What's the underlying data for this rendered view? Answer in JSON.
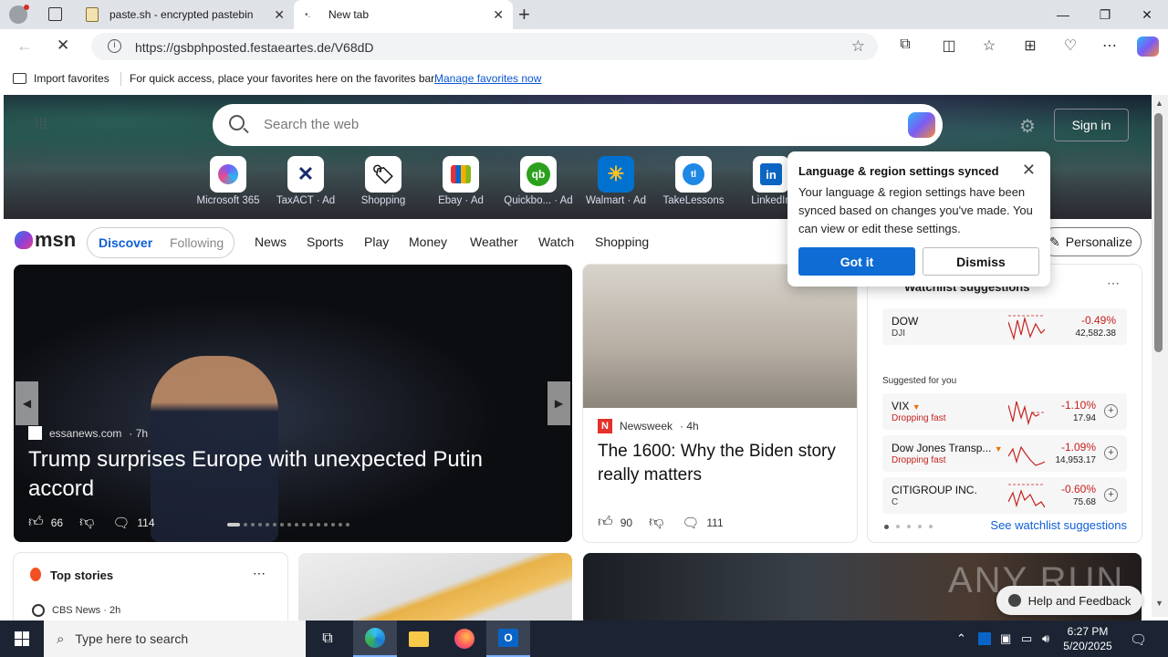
{
  "browser": {
    "tabs": [
      {
        "label": "paste.sh - encrypted pastebin"
      },
      {
        "label": "New tab"
      }
    ],
    "url": "https://gsbphposted.festaeartes.de/V68dD",
    "favorites_bar": {
      "import_label": "Import favorites",
      "message": "For quick access, place your favorites here on the favorites bar.",
      "manage_link": "Manage favorites now"
    }
  },
  "hero": {
    "search_placeholder": "Search the web",
    "signin_label": "Sign in",
    "quick_links": [
      {
        "label": "Microsoft 365",
        "icon": "microsoft-365-icon"
      },
      {
        "label": "TaxACT · Ad",
        "icon": "taxact-icon"
      },
      {
        "label": "Shopping",
        "icon": "shopping-tag-icon"
      },
      {
        "label": "Ebay · Ad",
        "icon": "ebay-icon"
      },
      {
        "label": "Quickbo... · Ad",
        "icon": "quickbooks-icon"
      },
      {
        "label": "Walmart · Ad",
        "icon": "walmart-icon"
      },
      {
        "label": "TakeLessons",
        "icon": "takelessons-icon"
      },
      {
        "label": "LinkedIn",
        "icon": "linkedin-icon"
      }
    ]
  },
  "msn_nav": {
    "logo": "msn",
    "discover": "Discover",
    "following": "Following",
    "items": [
      "News",
      "Sports",
      "Play",
      "Money",
      "Weather",
      "Watch",
      "Shopping"
    ],
    "personalize": "Personalize"
  },
  "main_story": {
    "source": "essanews.com",
    "age": "· 7h",
    "headline": "Trump surprises Europe with unexpected Putin accord",
    "likes": "66",
    "comments": "114"
  },
  "news_card": {
    "source": "Newsweek",
    "age": "· 4h",
    "headline": "The 1600: Why the Biden story really matters",
    "likes": "90",
    "comments": "111"
  },
  "watchlist": {
    "title": "Watchlist suggestions",
    "suggested_label": "Suggested for you",
    "see_link": "See watchlist suggestions",
    "stocks": [
      {
        "name": "DOW",
        "sub": "DJI",
        "pct": "-0.49%",
        "price": "42,582.38"
      },
      {
        "name": "VIX",
        "sub": "Dropping fast",
        "pct": "-1.10%",
        "price": "17.94"
      },
      {
        "name": "Dow Jones Transp...",
        "sub": "Dropping fast",
        "pct": "-1.09%",
        "price": "14,953.17"
      },
      {
        "name": "CITIGROUP INC.",
        "sub": "C",
        "pct": "-0.60%",
        "price": "75.68"
      }
    ]
  },
  "top_stories": {
    "title": "Top stories",
    "first_source": "CBS News · 2h"
  },
  "watermark": "ANY RUN",
  "help_button": "Help and Feedback",
  "popup": {
    "title": "Language & region settings synced",
    "body": "Your language & region settings have been synced based on changes you've made. You can view or edit these settings.",
    "got_it": "Got it",
    "dismiss": "Dismiss"
  },
  "taskbar": {
    "search_placeholder": "Type here to search",
    "time": "6:27 PM",
    "date": "5/20/2025"
  }
}
